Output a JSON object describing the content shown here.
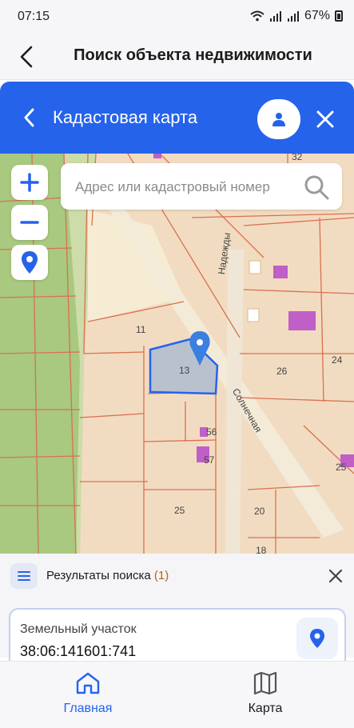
{
  "status_bar": {
    "time": "07:15",
    "battery": "67%"
  },
  "header": {
    "title": "Поиск объекта недвижимости"
  },
  "map_panel": {
    "title": "Кадастовая карта"
  },
  "search": {
    "placeholder": "Адрес или кадастровый номер"
  },
  "map": {
    "street_labels": [
      "Надежды",
      "Солнечная"
    ],
    "parcel_labels": [
      "32",
      "11",
      "13",
      "26",
      "24",
      "56",
      "57",
      "25",
      "20",
      "18",
      "25"
    ]
  },
  "results": {
    "title": "Результаты поиска",
    "count": "(1)",
    "item": {
      "type": "Земельный участок",
      "cadastral_number": "38:06:141601:741"
    }
  },
  "nav": {
    "home_label": "Главная",
    "map_label": "Карта",
    "active_color": "#2563eb"
  },
  "colors": {
    "accent": "#2563eb",
    "parcel_line": "#d9704f",
    "building": "#c05fc7"
  }
}
